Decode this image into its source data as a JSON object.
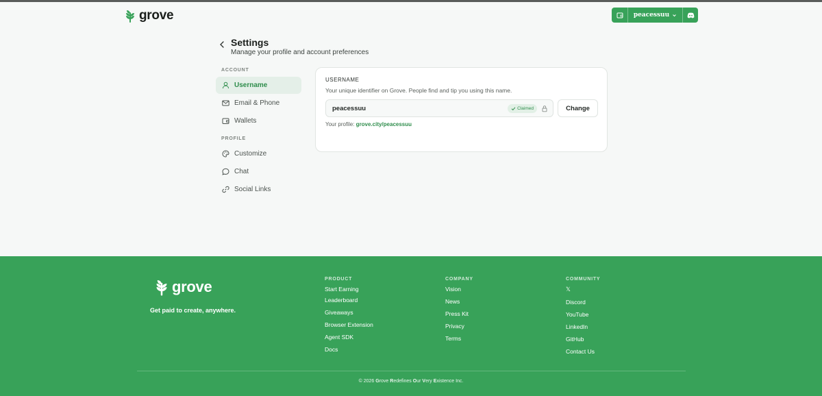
{
  "header": {
    "brand": "grove",
    "account_username": "peacessuu"
  },
  "settings": {
    "title": "Settings",
    "subtitle": "Manage your profile and account preferences"
  },
  "sidebar": {
    "groups": [
      {
        "label": "ACCOUNT",
        "items": [
          {
            "label": "Username",
            "icon": "user-icon",
            "active": true
          },
          {
            "label": "Email & Phone",
            "icon": "mail-icon"
          },
          {
            "label": "Wallets",
            "icon": "wallet-icon"
          }
        ]
      },
      {
        "label": "PROFILE",
        "items": [
          {
            "label": "Customize",
            "icon": "palette-icon"
          },
          {
            "label": "Chat",
            "icon": "chat-icon"
          },
          {
            "label": "Social Links",
            "icon": "link-icon"
          }
        ]
      }
    ]
  },
  "username_card": {
    "label": "USERNAME",
    "description": "Your unique identifier on Grove. People find and tip you using this name.",
    "value": "peacessuu",
    "badge": "Claimed",
    "button": "Change",
    "profile_prefix": "Your profile:",
    "profile_url": "grove.city/peacessuu"
  },
  "footer": {
    "brand": "grove",
    "tagline": "Get paid to create, anywhere.",
    "columns": [
      {
        "title": "PRODUCT",
        "links": [
          "Start Earning",
          "Leaderboard",
          "Giveaways",
          "Browser Extension",
          "Agent SDK",
          "Docs"
        ]
      },
      {
        "title": "COMPANY",
        "links": [
          "Vision",
          "News",
          "Press Kit",
          "Privacy",
          "Terms"
        ]
      },
      {
        "title": "COMMUNITY",
        "links": [
          "𝕏",
          "Discord",
          "YouTube",
          "LinkedIn",
          "GitHub",
          "Contact Us"
        ]
      }
    ],
    "copyright_prefix": "© 2026 ",
    "copyright_words": [
      {
        "initial": "G",
        "rest": "rove"
      },
      {
        "initial": "R",
        "rest": "edefines"
      },
      {
        "initial": "O",
        "rest": "ur"
      },
      {
        "initial": "V",
        "rest": "ery"
      },
      {
        "initial": "E",
        "rest": "xistence"
      }
    ],
    "copyright_suffix": " Inc."
  },
  "colors": {
    "brand_green": "#38a259",
    "accent_text": "#2f8d4c",
    "background": "#f6f8f7"
  }
}
